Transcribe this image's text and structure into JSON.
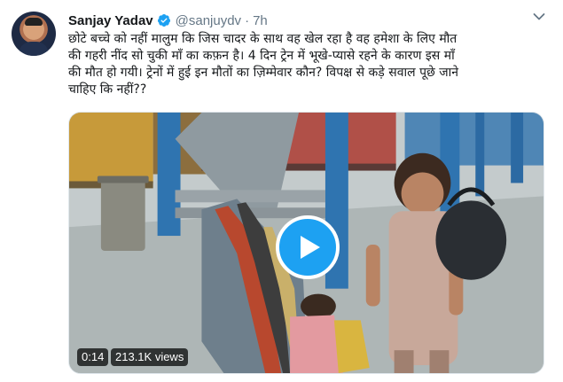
{
  "author": {
    "name": "Sanjay Yadav",
    "handle": "@sanjuydv",
    "separator": "·",
    "time": "7h",
    "avatar_icon": "profile-photo",
    "verified_icon": "verified-badge-icon"
  },
  "tweet": {
    "line1": "छोटे बच्चे को नहीं मालुम कि जिस चादर के साथ वह खेल रहा है वह हमेशा के लिए मौत",
    "line2": "की गहरी नींद सो चुकी माँ का कफ़न है। 4 दिन ट्रेन में भूखे-प्यासे रहने के कारण इस माँ",
    "line3": "की मौत हो गयी। ट्रेनों में हुई इन मौतों का ज़िम्मेवार कौन? विपक्ष से कड़े सवाल पूछे जाने",
    "line4": "चाहिए कि नहीं??"
  },
  "media": {
    "duration": "0:14",
    "views": "213.1K views",
    "play_icon": "play-icon"
  },
  "colors": {
    "accent": "#1da1f2",
    "text": "#14171a",
    "secondary_text": "#657786"
  }
}
